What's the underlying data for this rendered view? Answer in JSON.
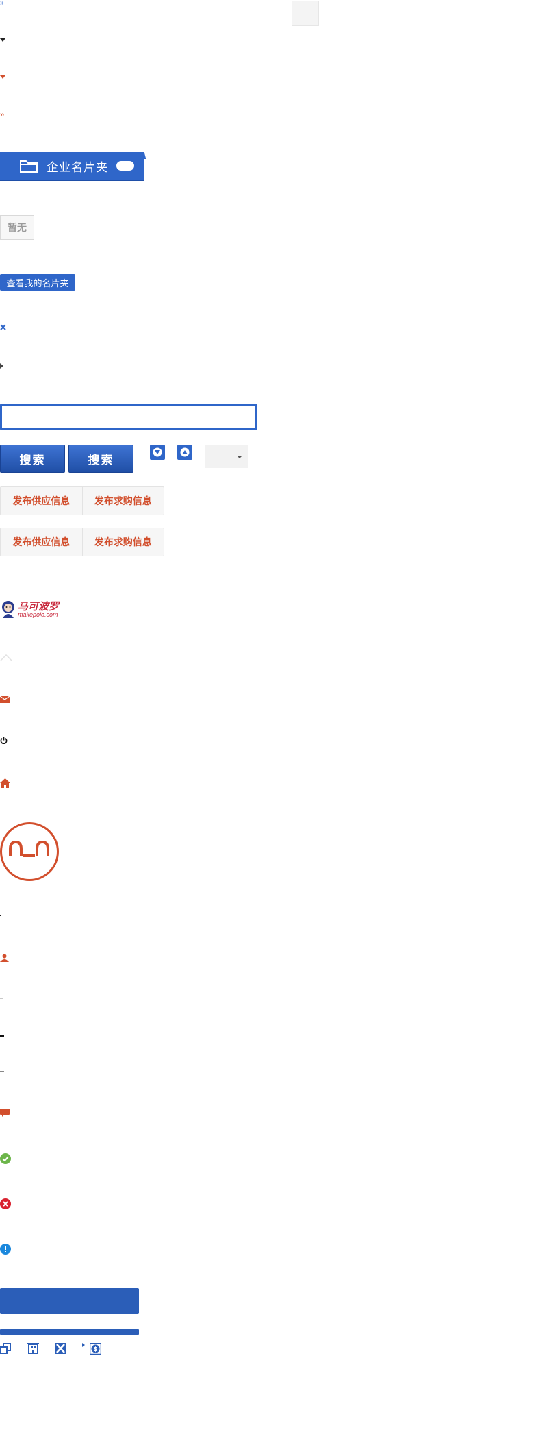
{
  "folder": {
    "label": "企业名片夹"
  },
  "empty_notice": {
    "text": "暂无"
  },
  "view_folder_button": {
    "label": "查看我的名片夹"
  },
  "search": {
    "placeholder": "",
    "button_1": "搜索",
    "button_2": "搜索"
  },
  "publish_row_1": {
    "supply": "发布供应信息",
    "purchase": "发布求购信息"
  },
  "publish_row_2": {
    "supply": "发布供应信息",
    "purchase": "发布求购信息"
  },
  "logo": {
    "name_cn": "马可波罗",
    "name_en": "makepolo.com"
  },
  "face_text": "∩_∩",
  "colors": {
    "brand_blue": "#2f66c9",
    "accent_red": "#d24f2d",
    "success_green": "#6cb54a",
    "error_red": "#d9222f",
    "info_blue": "#1b88dd"
  },
  "icons": [
    "double-chevron-right-blue-icon",
    "caret-down-dark-icon",
    "caret-down-red-icon",
    "double-chevron-right-red-icon",
    "folder-icon",
    "close-icon",
    "caret-right-icon",
    "arrow-down-icon",
    "arrow-up-icon",
    "chevron-up-light-icon",
    "mail-icon",
    "power-icon",
    "home-icon",
    "user-icon",
    "chat-icon",
    "check-circle-icon",
    "error-circle-icon",
    "info-circle-icon",
    "share-icon",
    "building-icon",
    "cross-box-icon",
    "dollar-icon"
  ]
}
